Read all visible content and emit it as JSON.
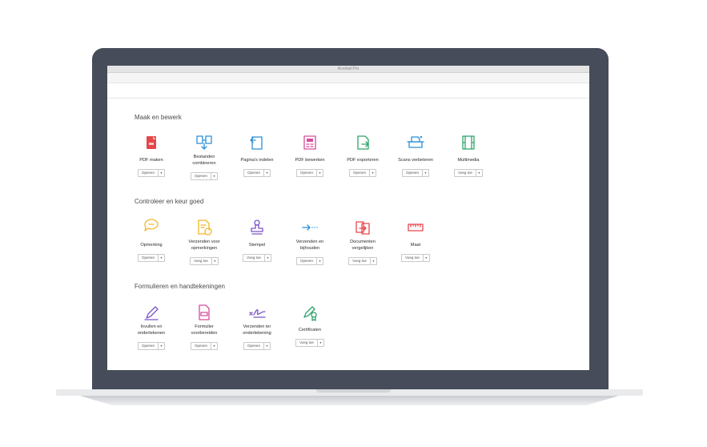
{
  "window": {
    "title": "Acrobat Pro"
  },
  "sections": [
    {
      "title": "Maak en bewerk",
      "tools": [
        {
          "label": "PDF maken",
          "button": "Openen",
          "icon": "pdf-create-icon",
          "color": "#e5474b"
        },
        {
          "label": "Bestanden\ncombineren",
          "button": "Openen",
          "icon": "combine-files-icon",
          "color": "#2a8fd8"
        },
        {
          "label": "Pagina's indelen",
          "button": "Openen",
          "icon": "organize-pages-icon",
          "color": "#2a8fd8"
        },
        {
          "label": "PDF bewerken",
          "button": "Openen",
          "icon": "edit-pdf-icon",
          "color": "#d64d9c"
        },
        {
          "label": "PDF exporteren",
          "button": "Openen",
          "icon": "export-pdf-icon",
          "color": "#2fa36b"
        },
        {
          "label": "Scans verbeteren",
          "button": "Openen",
          "icon": "scan-enhance-icon",
          "color": "#2a8fd8"
        },
        {
          "label": "Multimedia",
          "button": "Voeg toe",
          "icon": "multimedia-icon",
          "color": "#2fa36b"
        }
      ]
    },
    {
      "title": "Controleer en keur goed",
      "tools": [
        {
          "label": "Opmerking",
          "button": "Openen",
          "icon": "comment-icon",
          "color": "#f2b629"
        },
        {
          "label": "Verzenden voor\nopmerkingen",
          "button": "Voeg toe",
          "icon": "send-for-comments-icon",
          "color": "#f2b629"
        },
        {
          "label": "Stempel",
          "button": "Voeg toe",
          "icon": "stamp-icon",
          "color": "#7a55c9"
        },
        {
          "label": "Verzenden en\nbijhouden",
          "button": "Openen",
          "icon": "send-track-icon",
          "color": "#2a8fd8"
        },
        {
          "label": "Documenten\nvergelijken",
          "button": "Voeg toe",
          "icon": "compare-documents-icon",
          "color": "#e5474b"
        },
        {
          "label": "Maat",
          "button": "Voeg toe",
          "icon": "measure-icon",
          "color": "#e5474b"
        }
      ]
    },
    {
      "title": "Formulieren en handtekeningen",
      "tools": [
        {
          "label": "Invullen en\nondertekenen",
          "button": "Openen",
          "icon": "fill-sign-icon",
          "color": "#7a55c9"
        },
        {
          "label": "Formulier\nvoorbereiden",
          "button": "Openen",
          "icon": "prepare-form-icon",
          "color": "#d64d9c"
        },
        {
          "label": "Verzenden ter\nondertekening",
          "button": "Openen",
          "icon": "send-signature-icon",
          "color": "#7a55c9"
        },
        {
          "label": "Certificaten",
          "button": "Voeg toe",
          "icon": "certificate-icon",
          "color": "#2fa36b"
        }
      ]
    }
  ]
}
